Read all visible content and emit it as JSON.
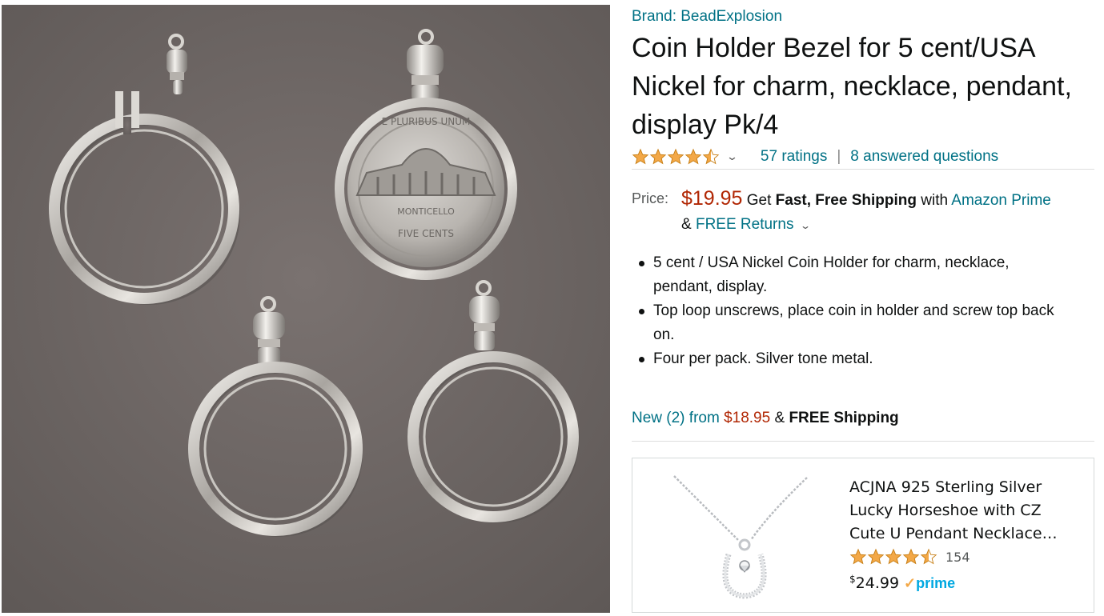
{
  "product": {
    "image_alt": "Coin holder bezels with USA nickel",
    "coin_text_top": "E PLURIBUS UNUM",
    "coin_text_mid": "MONTICELLO",
    "coin_text_value": "FIVE CENTS",
    "brand_label": "Brand: BeadExplosion",
    "title": "Coin Holder Bezel for 5 cent/USA Nickel for charm, necklace, pendant, display Pk/4",
    "rating": {
      "stars": 4.5,
      "icon": "star-icon",
      "dropdown_icon": "chevron-down-icon",
      "ratings_text": "57 ratings",
      "separator": "|",
      "questions_text": "8 answered questions"
    },
    "price": {
      "label": "Price:",
      "value": "$19.95",
      "shipping_pre": "Get",
      "shipping_bold": "Fast, Free Shipping",
      "shipping_with": "with",
      "prime_link": "Amazon Prime",
      "returns_pre": "&",
      "returns_link": "FREE Returns",
      "returns_icon": "chevron-down-icon"
    },
    "bullets": [
      "5 cent / USA Nickel Coin Holder for charm, necklace, pendant, display.",
      "Top loop unscrews, place coin in holder and screw top back on.",
      "Four per pack. Silver tone metal."
    ],
    "offers": {
      "link_text": "New (2) from",
      "price": "$18.95",
      "connector": "&",
      "shipping": "FREE Shipping"
    }
  },
  "sponsored": {
    "title": "ACJNA 925 Sterling Silver Lucky Horseshoe with CZ Cute U Pendant Necklace…",
    "stars": 4.5,
    "rating_count": "154",
    "currency": "$",
    "price": "24.99",
    "prime_check": "✓",
    "prime_label": "prime"
  },
  "colors": {
    "link": "#007185",
    "price": "#b12704",
    "star": "#f3a847",
    "image_bg": "#6f6866",
    "prime": "#00a8e1"
  }
}
